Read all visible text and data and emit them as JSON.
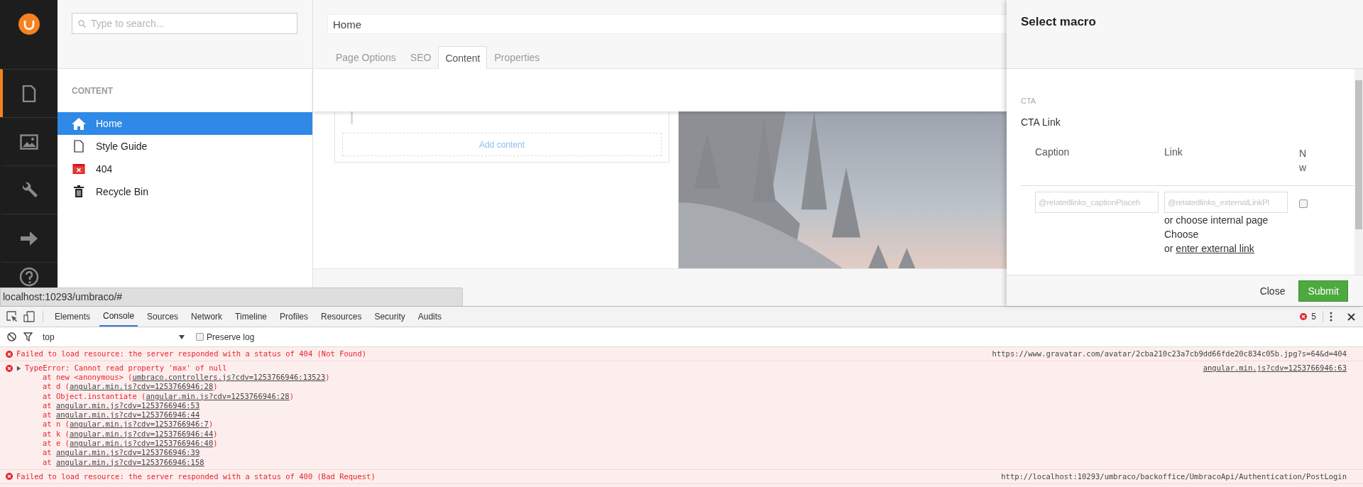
{
  "sections_nav": [
    {
      "kind": "content",
      "selected": true
    },
    {
      "kind": "media",
      "selected": false
    },
    {
      "kind": "settings",
      "selected": false
    },
    {
      "kind": "forward",
      "selected": false
    },
    {
      "kind": "help",
      "selected": false
    }
  ],
  "tree": {
    "search": {
      "placeholder": "Type to search..."
    },
    "heading": "CONTENT",
    "items": [
      {
        "label": "Home",
        "kind": "home",
        "selected": true
      },
      {
        "label": "Style Guide",
        "kind": "document",
        "selected": false
      },
      {
        "label": "404",
        "kind": "error-page",
        "selected": false
      },
      {
        "label": "Recycle Bin",
        "kind": "trash",
        "selected": false
      }
    ]
  },
  "editor": {
    "name": "Home",
    "tabs": [
      {
        "label": "Page Options",
        "selected": false
      },
      {
        "label": "SEO",
        "selected": false
      },
      {
        "label": "Content",
        "selected": true
      },
      {
        "label": "Properties",
        "selected": false
      }
    ],
    "add_content": "Add content"
  },
  "status_url": "localhost:10293/umbraco/#",
  "dialog": {
    "title": "Select macro",
    "group": "CTA",
    "property": "CTA Link",
    "columns": [
      "Caption",
      "Link",
      "N w"
    ],
    "caption_placeholder": "@relatedlinks_captionPlaceh",
    "link_placeholder": "@relatedlinks_externalLinkPl",
    "internal_text": "or choose internal page",
    "choose": "Choose",
    "or": "or",
    "external_link": "enter external link",
    "new_window": {
      "checked": false
    },
    "buttons": [
      {
        "label": "Close",
        "kind": "link"
      },
      {
        "label": "Submit",
        "kind": "primary"
      }
    ]
  },
  "devtools": {
    "tabs": [
      {
        "label": "Elements",
        "selected": false
      },
      {
        "label": "Console",
        "selected": true
      },
      {
        "label": "Sources",
        "selected": false
      },
      {
        "label": "Network",
        "selected": false
      },
      {
        "label": "Timeline",
        "selected": false
      },
      {
        "label": "Profiles",
        "selected": false
      },
      {
        "label": "Resources",
        "selected": false
      },
      {
        "label": "Security",
        "selected": false
      },
      {
        "label": "Audits",
        "selected": false
      }
    ],
    "error_count": "5",
    "context": "top",
    "preserve_log": {
      "label": "Preserve log",
      "checked": false
    },
    "messages": [
      {
        "text": "Failed to load resource: the server responded with a status of 404 (Not Found)",
        "source": "https://www.gravatar.com/avatar/2cba210c23a7cb9dd66fde20c834c05b.jpg?s=64&d=404",
        "source_is_link": false
      },
      {
        "text": "TypeError: Cannot read property 'max' of null",
        "source": "angular.min.js?cdv=1253766946:63",
        "source_is_link": true,
        "stack": [
          {
            "prefix": "at new <anonymous> (",
            "link": "umbraco.controllers.js?cdv=1253766946:13523",
            "suffix": ")"
          },
          {
            "prefix": "at d (",
            "link": "angular.min.js?cdv=1253766946:28",
            "suffix": ")"
          },
          {
            "prefix": "at Object.instantiate (",
            "link": "angular.min.js?cdv=1253766946:28",
            "suffix": ")"
          },
          {
            "prefix": "at ",
            "link": "angular.min.js?cdv=1253766946:53"
          },
          {
            "prefix": "at ",
            "link": "angular.min.js?cdv=1253766946:44"
          },
          {
            "prefix": "at n (",
            "link": "angular.min.js?cdv=1253766946:7",
            "suffix": ")"
          },
          {
            "prefix": "at k (",
            "link": "angular.min.js?cdv=1253766946:44",
            "suffix": ")"
          },
          {
            "prefix": "at e (",
            "link": "angular.min.js?cdv=1253766946:40",
            "suffix": ")"
          },
          {
            "prefix": "at ",
            "link": "angular.min.js?cdv=1253766946:39"
          },
          {
            "prefix": "at ",
            "link": "angular.min.js?cdv=1253766946:158"
          }
        ]
      },
      {
        "text": "Failed to load resource: the server responded with a status of 400 (Bad Request)",
        "source": "http://localhost:10293/umbraco/backoffice/UmbracoApi/Authentication/PostLogin",
        "source_is_link": false
      }
    ]
  }
}
